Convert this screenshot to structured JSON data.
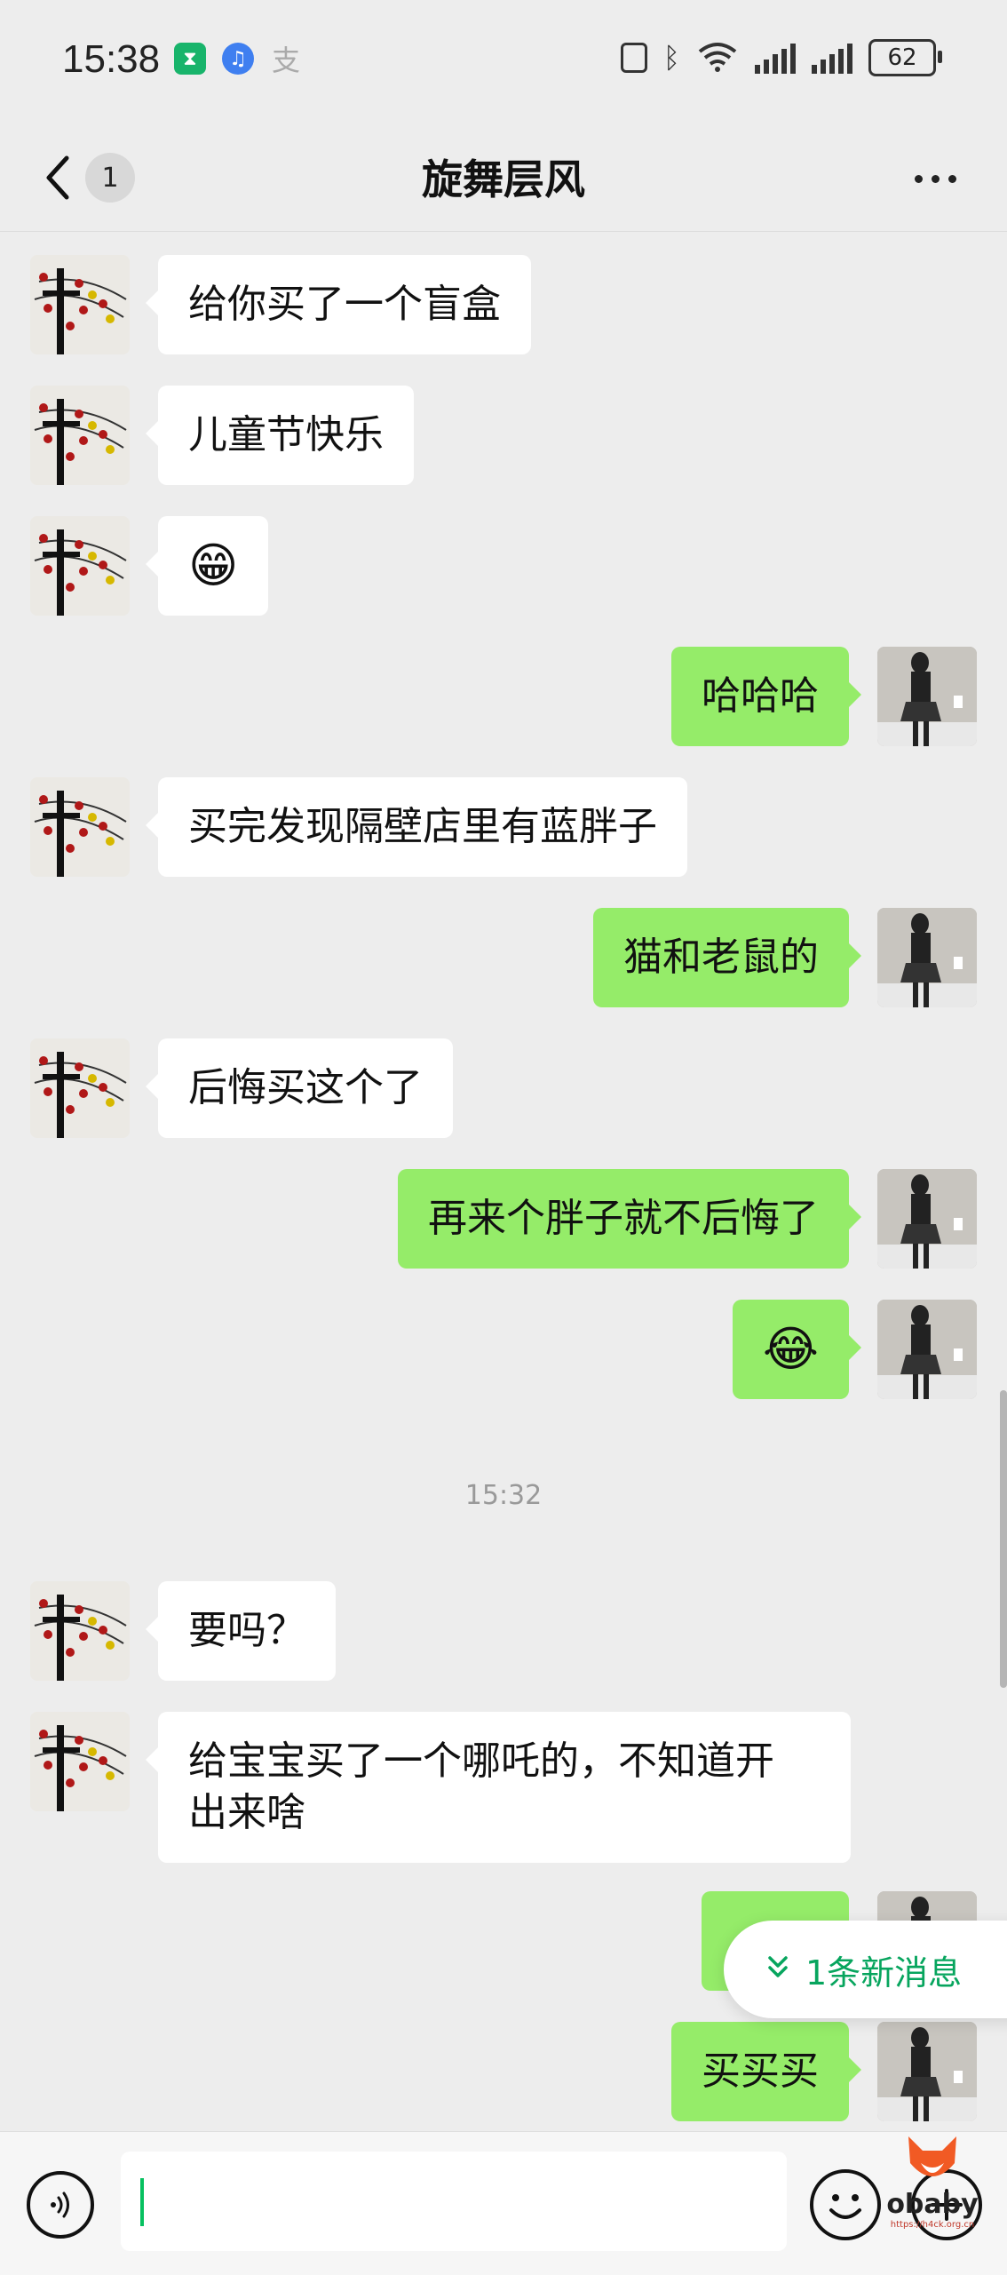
{
  "status_bar": {
    "time": "15:38",
    "battery": "62",
    "network": "6"
  },
  "header": {
    "unread_count": "1",
    "title": "旋舞层风"
  },
  "messages": [
    {
      "side": "left",
      "text": "给你买了一个盲盒"
    },
    {
      "side": "left",
      "text": "儿童节快乐"
    },
    {
      "side": "left",
      "emoji": "😁",
      "icon": "grinning-face-emoji"
    },
    {
      "side": "right",
      "text": "哈哈哈"
    },
    {
      "side": "left",
      "text": "买完发现隔壁店里有蓝胖子"
    },
    {
      "side": "right",
      "text": "猫和老鼠的"
    },
    {
      "side": "left",
      "text": "后悔买这个了"
    },
    {
      "side": "right",
      "text": "再来个胖子就不后悔了"
    },
    {
      "side": "right",
      "emoji": "😂",
      "icon": "tears-of-joy-emoji"
    },
    {
      "side": "left",
      "text": "要吗？"
    },
    {
      "side": "left",
      "text_line1": "给宝宝买了一个哪吒的，不知道开",
      "text_line2": "出来啥"
    },
    {
      "side": "right",
      "text": ""
    },
    {
      "side": "right",
      "text": "买买买"
    }
  ],
  "timestamp": "15:32",
  "new_message_pill": {
    "label": "1条新消息",
    "color": "#07a55e"
  },
  "watermark": {
    "name": "obaby",
    "url": "https://h4ck.org.cn"
  },
  "colors": {
    "background": "#ededed",
    "my_bubble": "#95ec69",
    "their_bubble": "#ffffff",
    "accent": "#07c160"
  }
}
